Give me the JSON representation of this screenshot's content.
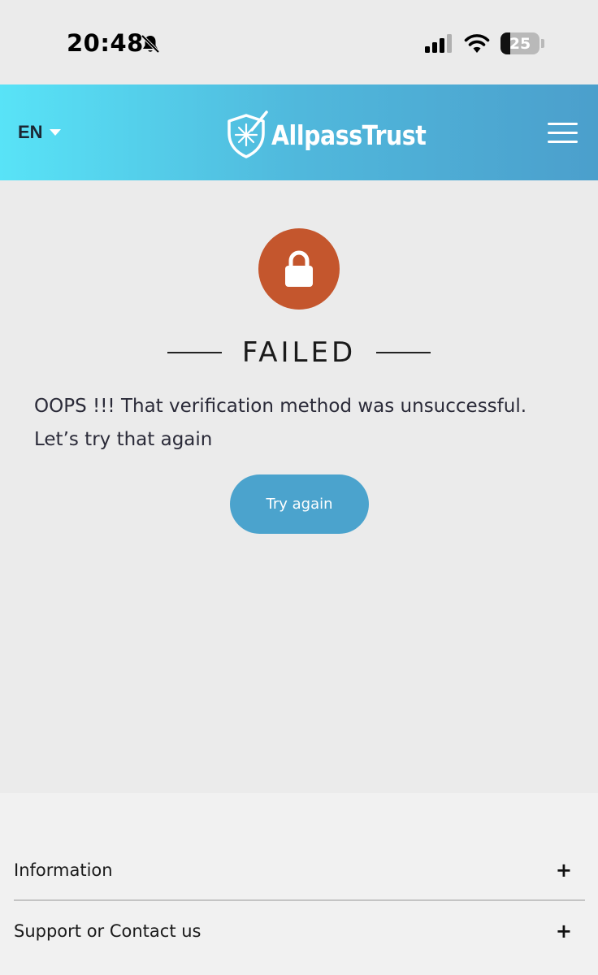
{
  "status_bar": {
    "time": "20:48",
    "battery_level": "25",
    "battery_fraction": 0.25,
    "icons": [
      "bell-off-icon",
      "signal-icon",
      "wifi-icon",
      "battery-icon"
    ]
  },
  "header": {
    "language": "EN",
    "logo_text": "AllpassTrust",
    "colors": {
      "gradient_start": "#58e3f7",
      "gradient_end": "#4b9fcc"
    }
  },
  "main": {
    "status_title": "FAILED",
    "message": "OOPS !!! That verification method was unsuccessful. Let’s try that again",
    "button_label": "Try again",
    "colors": {
      "lock_badge": "#c4562d",
      "button": "#4ba3cd"
    }
  },
  "footer": {
    "sections": [
      {
        "label": "Information",
        "toggle": "+"
      },
      {
        "label": "Support or Contact us",
        "toggle": "+"
      }
    ]
  }
}
